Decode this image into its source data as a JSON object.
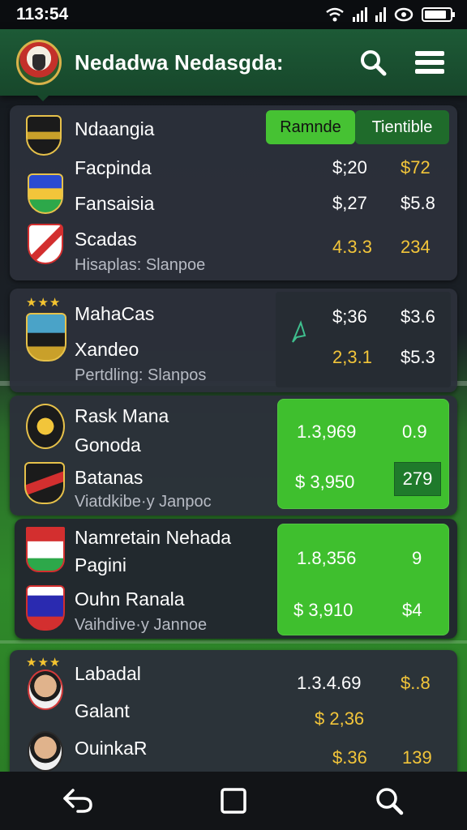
{
  "status_bar": {
    "time": "113:54"
  },
  "app_bar": {
    "title": "Nedadwa Nedasgda:"
  },
  "card1": {
    "header": "Ndaangia",
    "toggle_left": "Ramnde",
    "toggle_right": "Tientible",
    "rows": [
      {
        "name": "Facpinda",
        "value1": "$;20",
        "value2": "$72"
      },
      {
        "name": "Fansaisia",
        "value1": "$,27",
        "value2": "$5.8"
      },
      {
        "name": "Scadas",
        "value1": "4.3.3",
        "value2": "234"
      }
    ],
    "footer": "Hisaplas: Slanpoe"
  },
  "card2": {
    "rows": [
      {
        "name": "MahaCas",
        "value1": "$;36",
        "value2": "$3.6"
      },
      {
        "name": "Xandeo",
        "value1": "2,3.1",
        "value2": "$5.3"
      }
    ],
    "footer": "Pertdling: Slanpos"
  },
  "card3": {
    "rows": [
      {
        "name": "Rask Mana"
      },
      {
        "name": "Gonoda"
      },
      {
        "name": "Batanas"
      }
    ],
    "panel_values": [
      {
        "value1": "1.3,969",
        "value2": "0.9"
      },
      {
        "value1": "$ 3,950",
        "value2": "279"
      }
    ],
    "footer": "Viatdkibe·y Janpoc"
  },
  "card4": {
    "rows": [
      {
        "name": "Namretain Nehada"
      },
      {
        "name": "Pagini"
      },
      {
        "name": "Ouhn Ranala"
      }
    ],
    "panel_values": [
      {
        "value1": "1.8,356",
        "value2": "9"
      },
      {
        "value1": "$ 3,910",
        "value2": "$4"
      }
    ],
    "footer": "Vaihdive·y Jannoe"
  },
  "card5": {
    "rows": [
      {
        "name": "Labadal",
        "value1": "1.3.4.69",
        "value2": "$..8"
      },
      {
        "name": "Galant",
        "value1": "$ 2,36",
        "value2": ""
      },
      {
        "name": "OuinkaR",
        "value1": "$.36",
        "value2": "139"
      }
    ]
  },
  "colors": {
    "accent_green": "#3fbf2e",
    "gold": "#f2c53a",
    "header_green": "#1d5a36"
  },
  "icons": [
    "wifi-icon",
    "signal-icon",
    "eye-icon",
    "battery-icon",
    "search-icon",
    "menu-icon",
    "back-icon",
    "home-icon"
  ]
}
